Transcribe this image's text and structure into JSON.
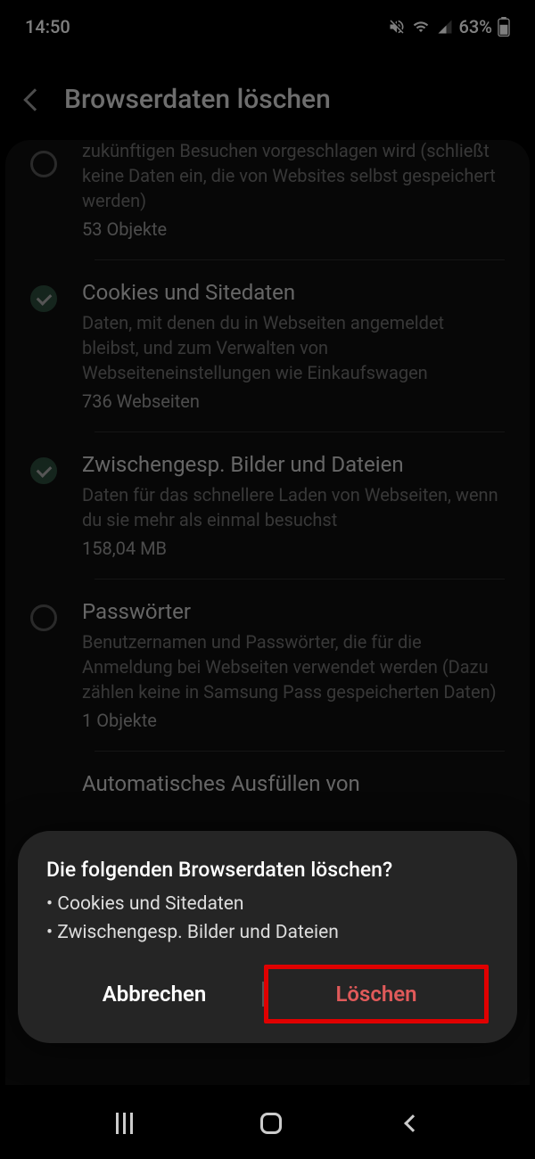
{
  "status": {
    "time": "14:50",
    "battery": "63%"
  },
  "header": {
    "title": "Browserdaten löschen"
  },
  "items": [
    {
      "checked": false,
      "desc": "zukünftigen Besuchen vorgeschlagen wird (schließt keine Daten ein, die von Websites selbst gespeichert werden)",
      "count": "53 Objekte"
    },
    {
      "checked": true,
      "title": "Cookies und Sitedaten",
      "desc": "Daten, mit denen du in Webseiten angemeldet bleibst, und zum Verwalten von Webseiteneinstellungen wie Einkaufswagen",
      "count": "736 Webseiten"
    },
    {
      "checked": true,
      "title": "Zwischengesp. Bilder und Dateien",
      "desc": "Daten für das schnellere Laden von Webseiten, wenn du sie mehr als einmal besuchst",
      "count": "158,04 MB"
    },
    {
      "checked": false,
      "title": "Passwörter",
      "desc": "Benutzernamen und Passwörter, die für die Anmeldung bei Webseiten verwendet werden (Dazu zählen keine in Samsung Pass gespeicherten Daten)",
      "count": "1 Objekte"
    },
    {
      "title": "Automatisches Ausfüllen von"
    }
  ],
  "dialog": {
    "title": "Die folgenden Browserdaten löschen?",
    "bullets": [
      "• Cookies und Sitedaten",
      "• Zwischengesp. Bilder und Dateien"
    ],
    "cancel": "Abbrechen",
    "confirm": "Löschen"
  }
}
